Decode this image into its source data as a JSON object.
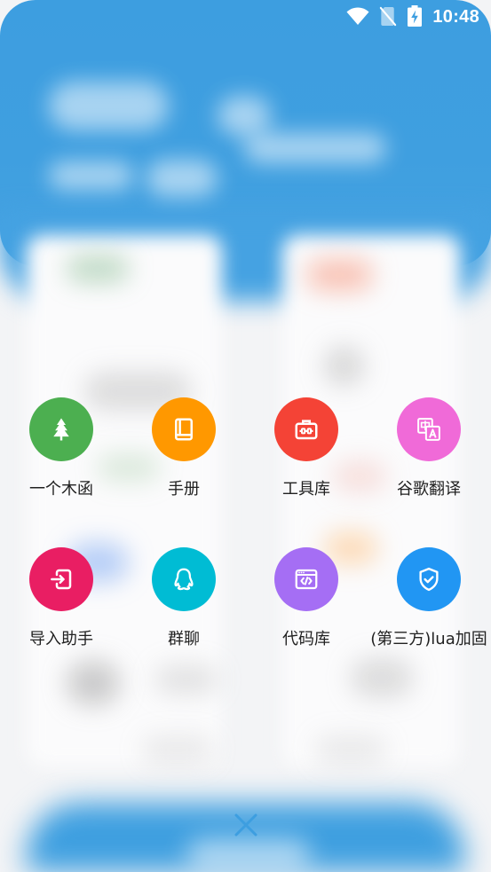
{
  "status_bar": {
    "time": "10:48",
    "icons": [
      "wifi-icon",
      "no-sim-icon",
      "battery-charging-icon"
    ]
  },
  "theme": {
    "accent": "#3d9ee0",
    "label_color": "#212121"
  },
  "menu": {
    "items": [
      {
        "label": "一个木函",
        "icon": "tree-icon",
        "color": "#4caf50"
      },
      {
        "label": "手册",
        "icon": "book-icon",
        "color": "#ff9800"
      },
      {
        "label": "工具库",
        "icon": "toolbox-icon",
        "color": "#f44336"
      },
      {
        "label": "谷歌翻译",
        "icon": "translate-icon",
        "color": "#f06ad8"
      },
      {
        "label": "导入助手",
        "icon": "import-icon",
        "color": "#e91e63"
      },
      {
        "label": "群聊",
        "icon": "qq-icon",
        "color": "#00bcd4"
      },
      {
        "label": "代码库",
        "icon": "code-icon",
        "color": "#a56ef4"
      },
      {
        "label": "(第三方)lua加固",
        "icon": "shield-check-icon",
        "color": "#2196f3"
      }
    ]
  },
  "close_button": {
    "icon": "close-icon",
    "color": "#3d9ee0"
  }
}
